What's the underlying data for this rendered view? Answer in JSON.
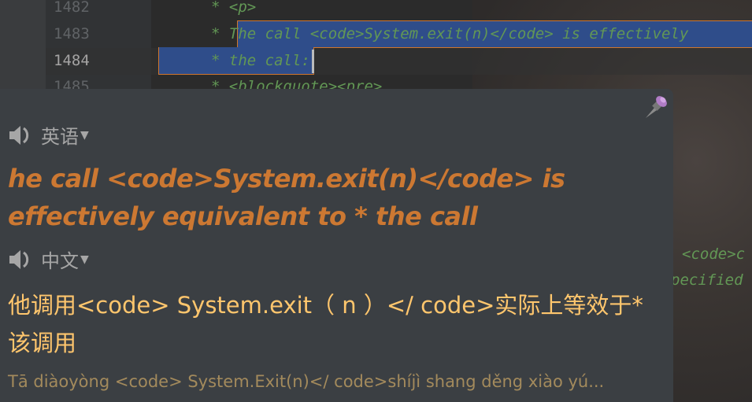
{
  "editor": {
    "lines": [
      {
        "number": "1482",
        "text": "* <p>"
      },
      {
        "number": "1483",
        "text": "* The call <code>System.exit(n)</code> is effectively"
      },
      {
        "number": "1484",
        "text": "* the call:"
      },
      {
        "number": "1485",
        "text": "* <blockquote><pre>"
      }
    ],
    "background_fragments": [
      "<code>c",
      "pecified"
    ]
  },
  "popup": {
    "source_lang": "英语",
    "target_lang": "中文",
    "source_text": "he call <code>System.exit(n)</code> is effectively equivalent to * the call",
    "translation": "他调用<code> System.exit（ n ）</ code>实际上等效于*该调用",
    "pinyin": "Tā diàoyòng <code> System.Exit(n)</ code>shíjì shang děng xiào yú...",
    "icons": {
      "speaker": "speaker-icon",
      "pin": "pin-icon",
      "dropdown": "triangle-down-icon"
    },
    "colors": {
      "source": "#cc7832",
      "translation": "#ffc66d",
      "pinyin": "#a38a5c"
    }
  }
}
